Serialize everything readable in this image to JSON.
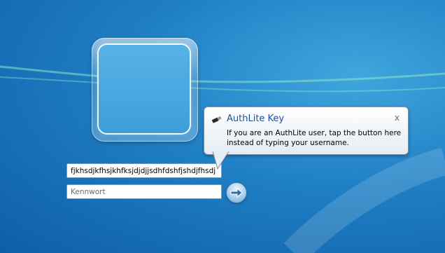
{
  "login": {
    "username_value": "fjkhsdjkfhsjkhfksjdjdjjsdhfdshfjshdjfhsdj",
    "password_placeholder": "Kennwort"
  },
  "tooltip": {
    "title": "AuthLite Key",
    "body": "If you are an AuthLite user, tap the button here instead of typing your username.",
    "close_label": "x",
    "icon": "usb-key-icon"
  },
  "submit": {
    "icon": "arrow-right-icon"
  },
  "colors": {
    "background": "#1f7fc4",
    "tooltip_title": "#1f4f9b",
    "tooltip_border": "#7b8ea3"
  }
}
